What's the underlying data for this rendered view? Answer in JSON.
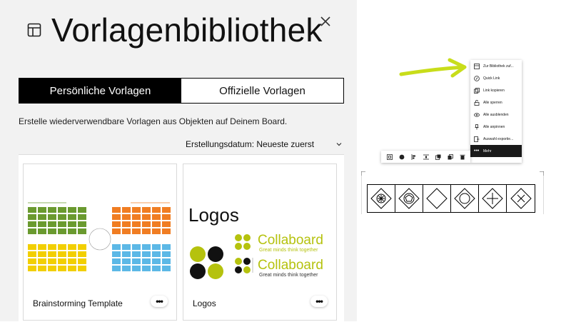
{
  "panel": {
    "title": "Vorlagenbibliothek",
    "tabs": [
      {
        "label": "Persönliche Vorlagen",
        "active": true
      },
      {
        "label": "Offizielle Vorlagen",
        "active": false
      }
    ],
    "description": "Erstelle wiederverwendbare Vorlagen aus Objekten auf Deinem Board.",
    "sort_label": "Erstellungsdatum: Neueste zuerst",
    "cards": [
      {
        "name": "Brainstorming Template"
      },
      {
        "name": "Logos",
        "thumb_title": "Logos",
        "brand": "Collaboard",
        "tagline": "Great minds think together"
      }
    ]
  },
  "context_menu": {
    "items": [
      {
        "label": "Zur Bibliothek zuf...",
        "icon": "library-icon"
      },
      {
        "label": "Quick Link",
        "icon": "quick-link-icon"
      },
      {
        "label": "Link kopieren",
        "icon": "copy-link-icon"
      },
      {
        "label": "Alle sperren",
        "icon": "lock-icon"
      },
      {
        "label": "Alle ausblenden",
        "icon": "eye-icon"
      },
      {
        "label": "Alle anpinnen",
        "icon": "pin-icon"
      },
      {
        "label": "Auswahl exportie...",
        "icon": "export-icon"
      },
      {
        "label": "Mehr",
        "icon": "more-icon",
        "selected": true
      }
    ]
  },
  "colors": {
    "green": "#6a9a2f",
    "orange": "#f07d22",
    "yellow": "#f2cf00",
    "blue": "#5cb8e6",
    "lime": "#b5c20e",
    "accent_arrow": "#c8dd1a"
  }
}
